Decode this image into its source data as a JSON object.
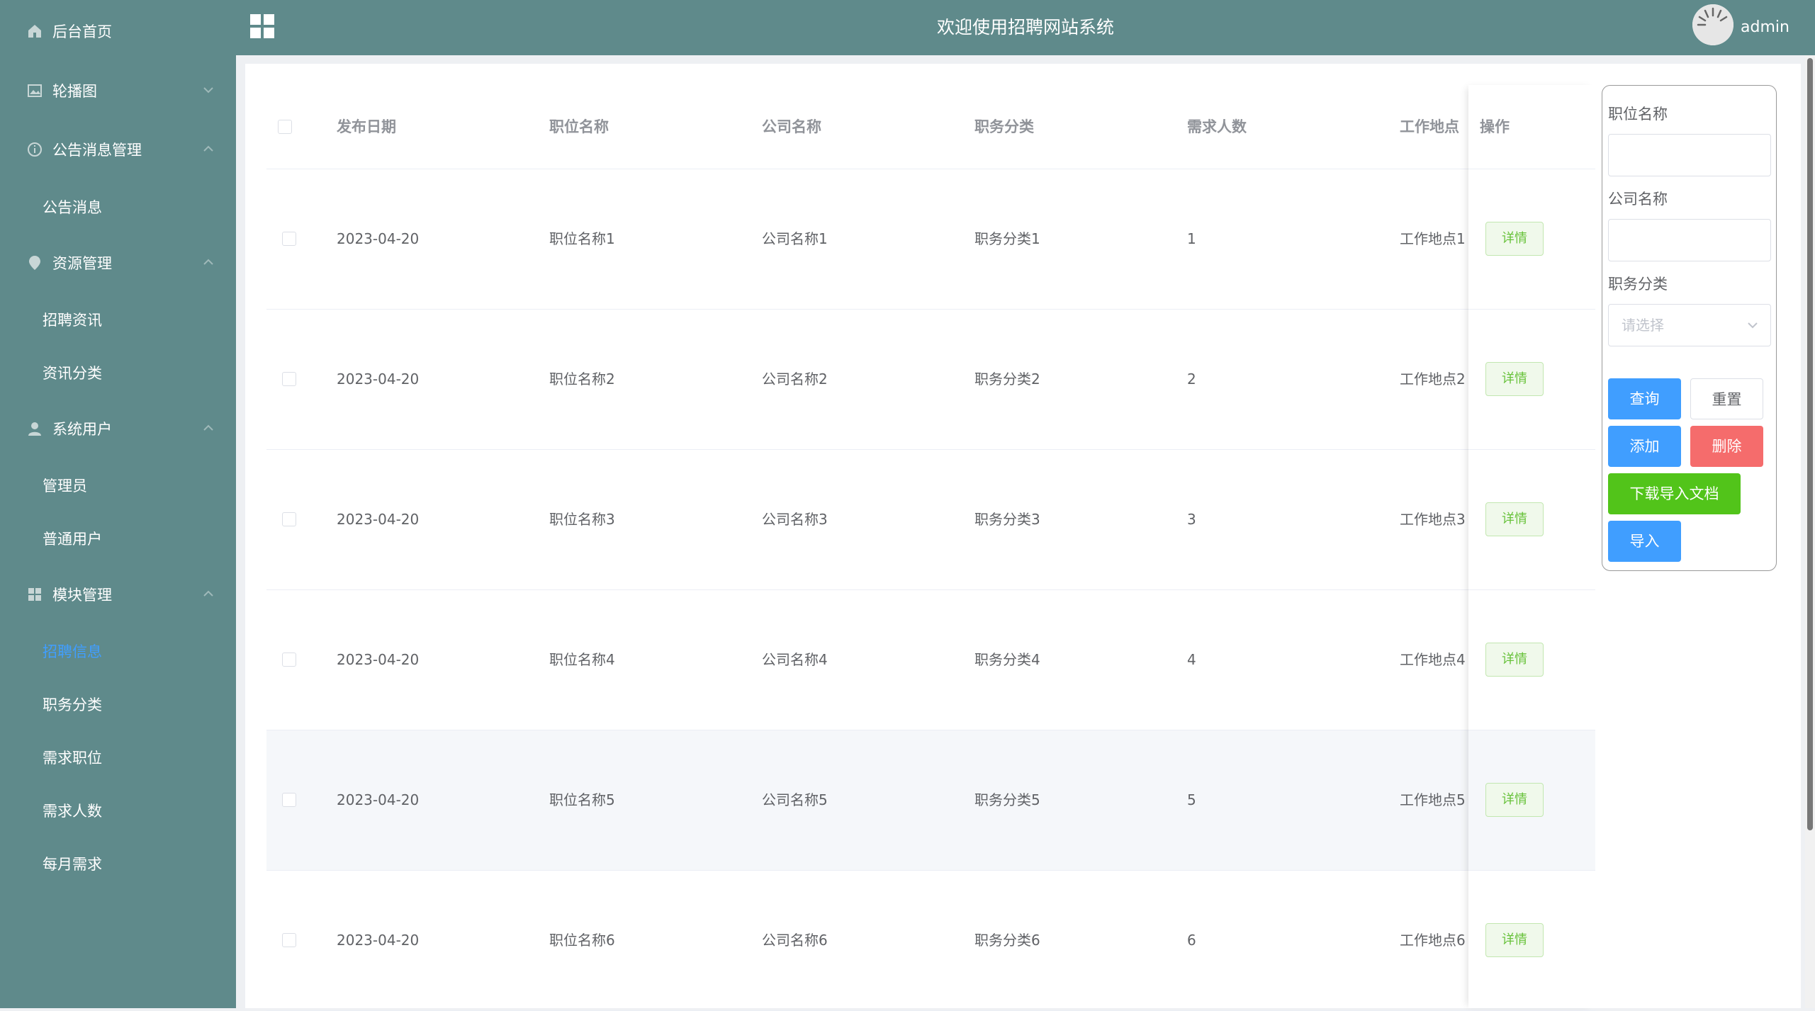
{
  "header": {
    "title": "欢迎使用招聘网站系统",
    "username": "admin"
  },
  "sidebar": {
    "items": [
      {
        "label": "后台首页",
        "icon": "home-icon"
      },
      {
        "label": "轮播图",
        "icon": "image-icon"
      },
      {
        "label": "公告消息管理",
        "icon": "info-icon"
      },
      {
        "label": "公告消息"
      },
      {
        "label": "资源管理",
        "icon": "location-icon"
      },
      {
        "label": "招聘资讯"
      },
      {
        "label": "资讯分类"
      },
      {
        "label": "系统用户",
        "icon": "user-icon"
      },
      {
        "label": "管理员"
      },
      {
        "label": "普通用户"
      },
      {
        "label": "模块管理",
        "icon": "grid-icon"
      },
      {
        "label": "招聘信息",
        "active": true
      },
      {
        "label": "职务分类"
      },
      {
        "label": "需求职位"
      },
      {
        "label": "需求人数"
      },
      {
        "label": "每月需求"
      }
    ]
  },
  "table": {
    "headers": [
      "发布日期",
      "职位名称",
      "公司名称",
      "职务分类",
      "需求人数",
      "工作地点",
      "操作"
    ],
    "rows": [
      {
        "date": "2023-04-20",
        "position": "职位名称1",
        "company": "公司名称1",
        "category": "职务分类1",
        "count": "1",
        "location": "工作地点1",
        "action": "详情"
      },
      {
        "date": "2023-04-20",
        "position": "职位名称2",
        "company": "公司名称2",
        "category": "职务分类2",
        "count": "2",
        "location": "工作地点2",
        "action": "详情"
      },
      {
        "date": "2023-04-20",
        "position": "职位名称3",
        "company": "公司名称3",
        "category": "职务分类3",
        "count": "3",
        "location": "工作地点3",
        "action": "详情"
      },
      {
        "date": "2023-04-20",
        "position": "职位名称4",
        "company": "公司名称4",
        "category": "职务分类4",
        "count": "4",
        "location": "工作地点4",
        "action": "详情"
      },
      {
        "date": "2023-04-20",
        "position": "职位名称5",
        "company": "公司名称5",
        "category": "职务分类5",
        "count": "5",
        "location": "工作地点5",
        "action": "详情"
      },
      {
        "date": "2023-04-20",
        "position": "职位名称6",
        "company": "公司名称6",
        "category": "职务分类6",
        "count": "6",
        "location": "工作地点6",
        "action": "详情"
      }
    ]
  },
  "search": {
    "position_label": "职位名称",
    "company_label": "公司名称",
    "category_label": "职务分类",
    "category_placeholder": "请选择",
    "query_btn": "查询",
    "reset_btn": "重置",
    "add_btn": "添加",
    "delete_btn": "删除",
    "download_btn": "下载导入文档",
    "import_btn": "导入"
  },
  "colors": {
    "sidebar_bg": "#5f8a8b",
    "primary": "#409eff",
    "danger": "#f56c6c",
    "success": "#52c41a",
    "active_text": "#409eff"
  }
}
